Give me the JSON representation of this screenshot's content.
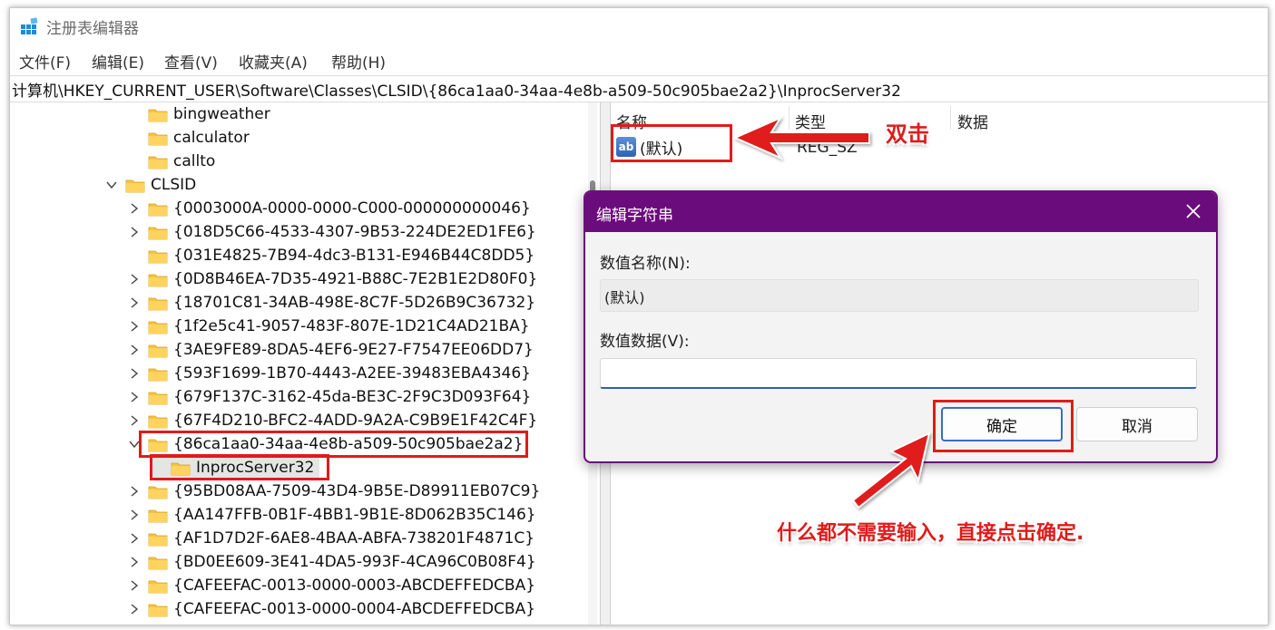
{
  "window": {
    "title": "注册表编辑器"
  },
  "menu": {
    "items": [
      "文件(F)",
      "编辑(E)",
      "查看(V)",
      "收藏夹(A)",
      "帮助(H)"
    ]
  },
  "address": {
    "path": "计算机\\HKEY_CURRENT_USER\\Software\\Classes\\CLSID\\{86ca1aa0-34aa-4e8b-a509-50c905bae2a2}\\InprocServer32"
  },
  "tree": {
    "items": [
      {
        "label": "bingweather",
        "expanded": false,
        "has_children": false
      },
      {
        "label": "calculator",
        "expanded": false,
        "has_children": false
      },
      {
        "label": "callto",
        "expanded": false,
        "has_children": false
      },
      {
        "label": "CLSID",
        "expanded": true,
        "has_children": true
      },
      {
        "label": "{0003000A-0000-0000-C000-000000000046}",
        "expanded": false,
        "has_children": true
      },
      {
        "label": "{018D5C66-4533-4307-9B53-224DE2ED1FE6}",
        "expanded": false,
        "has_children": true
      },
      {
        "label": "{031E4825-7B94-4dc3-B131-E946B44C8DD5}",
        "expanded": false,
        "has_children": false
      },
      {
        "label": "{0D8B46EA-7D35-4921-B88C-7E2B1E2D80F0}",
        "expanded": false,
        "has_children": true
      },
      {
        "label": "{18701C81-34AB-498E-8C7F-5D26B9C36732}",
        "expanded": false,
        "has_children": true
      },
      {
        "label": "{1f2e5c41-9057-483F-807E-1D21C4AD21BA}",
        "expanded": false,
        "has_children": true
      },
      {
        "label": "{3AE9FE89-8DA5-4EF6-9E27-F7547EE06DD7}",
        "expanded": false,
        "has_children": true
      },
      {
        "label": "{593F1699-1B70-4443-A2EE-39483EBA4346}",
        "expanded": false,
        "has_children": true
      },
      {
        "label": "{679F137C-3162-45da-BE3C-2F9C3D093F64}",
        "expanded": false,
        "has_children": true
      },
      {
        "label": "{67F4D210-BFC2-4ADD-9A2A-C9B9E1F42C4F}",
        "expanded": false,
        "has_children": true
      },
      {
        "label": "{86ca1aa0-34aa-4e8b-a509-50c905bae2a2}",
        "expanded": true,
        "has_children": true
      },
      {
        "label": "InprocServer32",
        "expanded": false,
        "has_children": false,
        "selected": true
      },
      {
        "label": "{95BD08AA-7509-43D4-9B5E-D89911EB07C9}",
        "expanded": false,
        "has_children": true
      },
      {
        "label": "{AA147FFB-0B1F-4BB1-9B1E-8D062B35C146}",
        "expanded": false,
        "has_children": true
      },
      {
        "label": "{AF1D7D2F-6AE8-4BAA-ABFA-738201F4871C}",
        "expanded": false,
        "has_children": true
      },
      {
        "label": "{BD0EE609-3E41-4DA5-993F-4CA96C0B08F4}",
        "expanded": false,
        "has_children": true
      },
      {
        "label": "{CAFEEFAC-0013-0000-0003-ABCDEFFEDCBA}",
        "expanded": false,
        "has_children": true
      },
      {
        "label": "{CAFEEFAC-0013-0000-0004-ABCDEFFEDCBA}",
        "expanded": false,
        "has_children": true
      }
    ]
  },
  "values": {
    "columns": [
      "名称",
      "类型",
      "数据"
    ],
    "rows": [
      {
        "name": "(默认)",
        "type": "REG_SZ",
        "icon": "ab-icon"
      }
    ]
  },
  "dialog": {
    "title": "编辑字符串",
    "name_label": "数值名称(N):",
    "name_value": "(默认)",
    "data_label": "数值数据(V):",
    "data_value": "",
    "ok_label": "确定",
    "cancel_label": "取消"
  },
  "annotations": {
    "double_click": "双击",
    "instruction": "什么都不需要输入，直接点击确定."
  },
  "colors": {
    "dialog_titlebar": "#6b0c7d",
    "annotation_red": "#e01b1b",
    "folder_yellow": "#f6c342",
    "selection": "#e5e5e5"
  }
}
